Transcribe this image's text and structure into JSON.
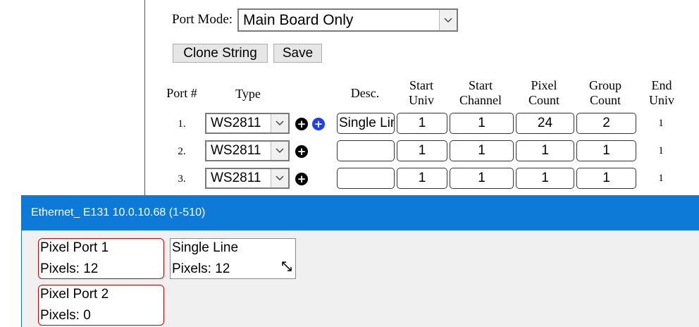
{
  "port_mode": {
    "label": "Port Mode:",
    "value": "Main Board Only"
  },
  "buttons": {
    "clone": "Clone String",
    "save": "Save"
  },
  "columns": [
    "Port #",
    "Type",
    "Desc.",
    "Start Univ",
    "Start Channel",
    "Pixel Count",
    "Group Count",
    "End Univ"
  ],
  "column_lines": [
    [
      "Port #"
    ],
    [
      "Type"
    ],
    [
      "Desc."
    ],
    [
      "Start",
      "Univ"
    ],
    [
      "Start",
      "Channel"
    ],
    [
      "Pixel",
      "Count"
    ],
    [
      "Group",
      "Count"
    ],
    [
      "End",
      "Univ"
    ]
  ],
  "rows": [
    {
      "num": "1.",
      "type": "WS2811",
      "desc": "Single Line",
      "start_univ": "1",
      "start_channel": "1",
      "pixel_count": "24",
      "group_count": "2",
      "end_univ": "1"
    },
    {
      "num": "2.",
      "type": "WS2811",
      "desc": "",
      "start_univ": "1",
      "start_channel": "1",
      "pixel_count": "1",
      "group_count": "1",
      "end_univ": "1"
    },
    {
      "num": "3.",
      "type": "WS2811",
      "desc": "",
      "start_univ": "1",
      "start_channel": "1",
      "pixel_count": "1",
      "group_count": "1",
      "end_univ": "1"
    }
  ],
  "icons": {
    "add": "plus-circle-icon",
    "add_blue": "plus-circle-blue-icon",
    "dropdown": "chevron-down-icon",
    "resize": "resize-arrow-icon"
  },
  "window": {
    "title": "Ethernet_ E131 10.0.10.68 (1-510)",
    "ports": [
      {
        "name": "Pixel Port 1",
        "pixels": "Pixels: 12"
      },
      {
        "name": "Pixel Port 2",
        "pixels": "Pixels: 0"
      }
    ],
    "string": {
      "name": "Single Line",
      "pixels": "Pixels: 12"
    }
  },
  "colors": {
    "title_bar": "#0e7ad8",
    "port_border": "#cc0000",
    "add_blue": "#1f3cff"
  }
}
